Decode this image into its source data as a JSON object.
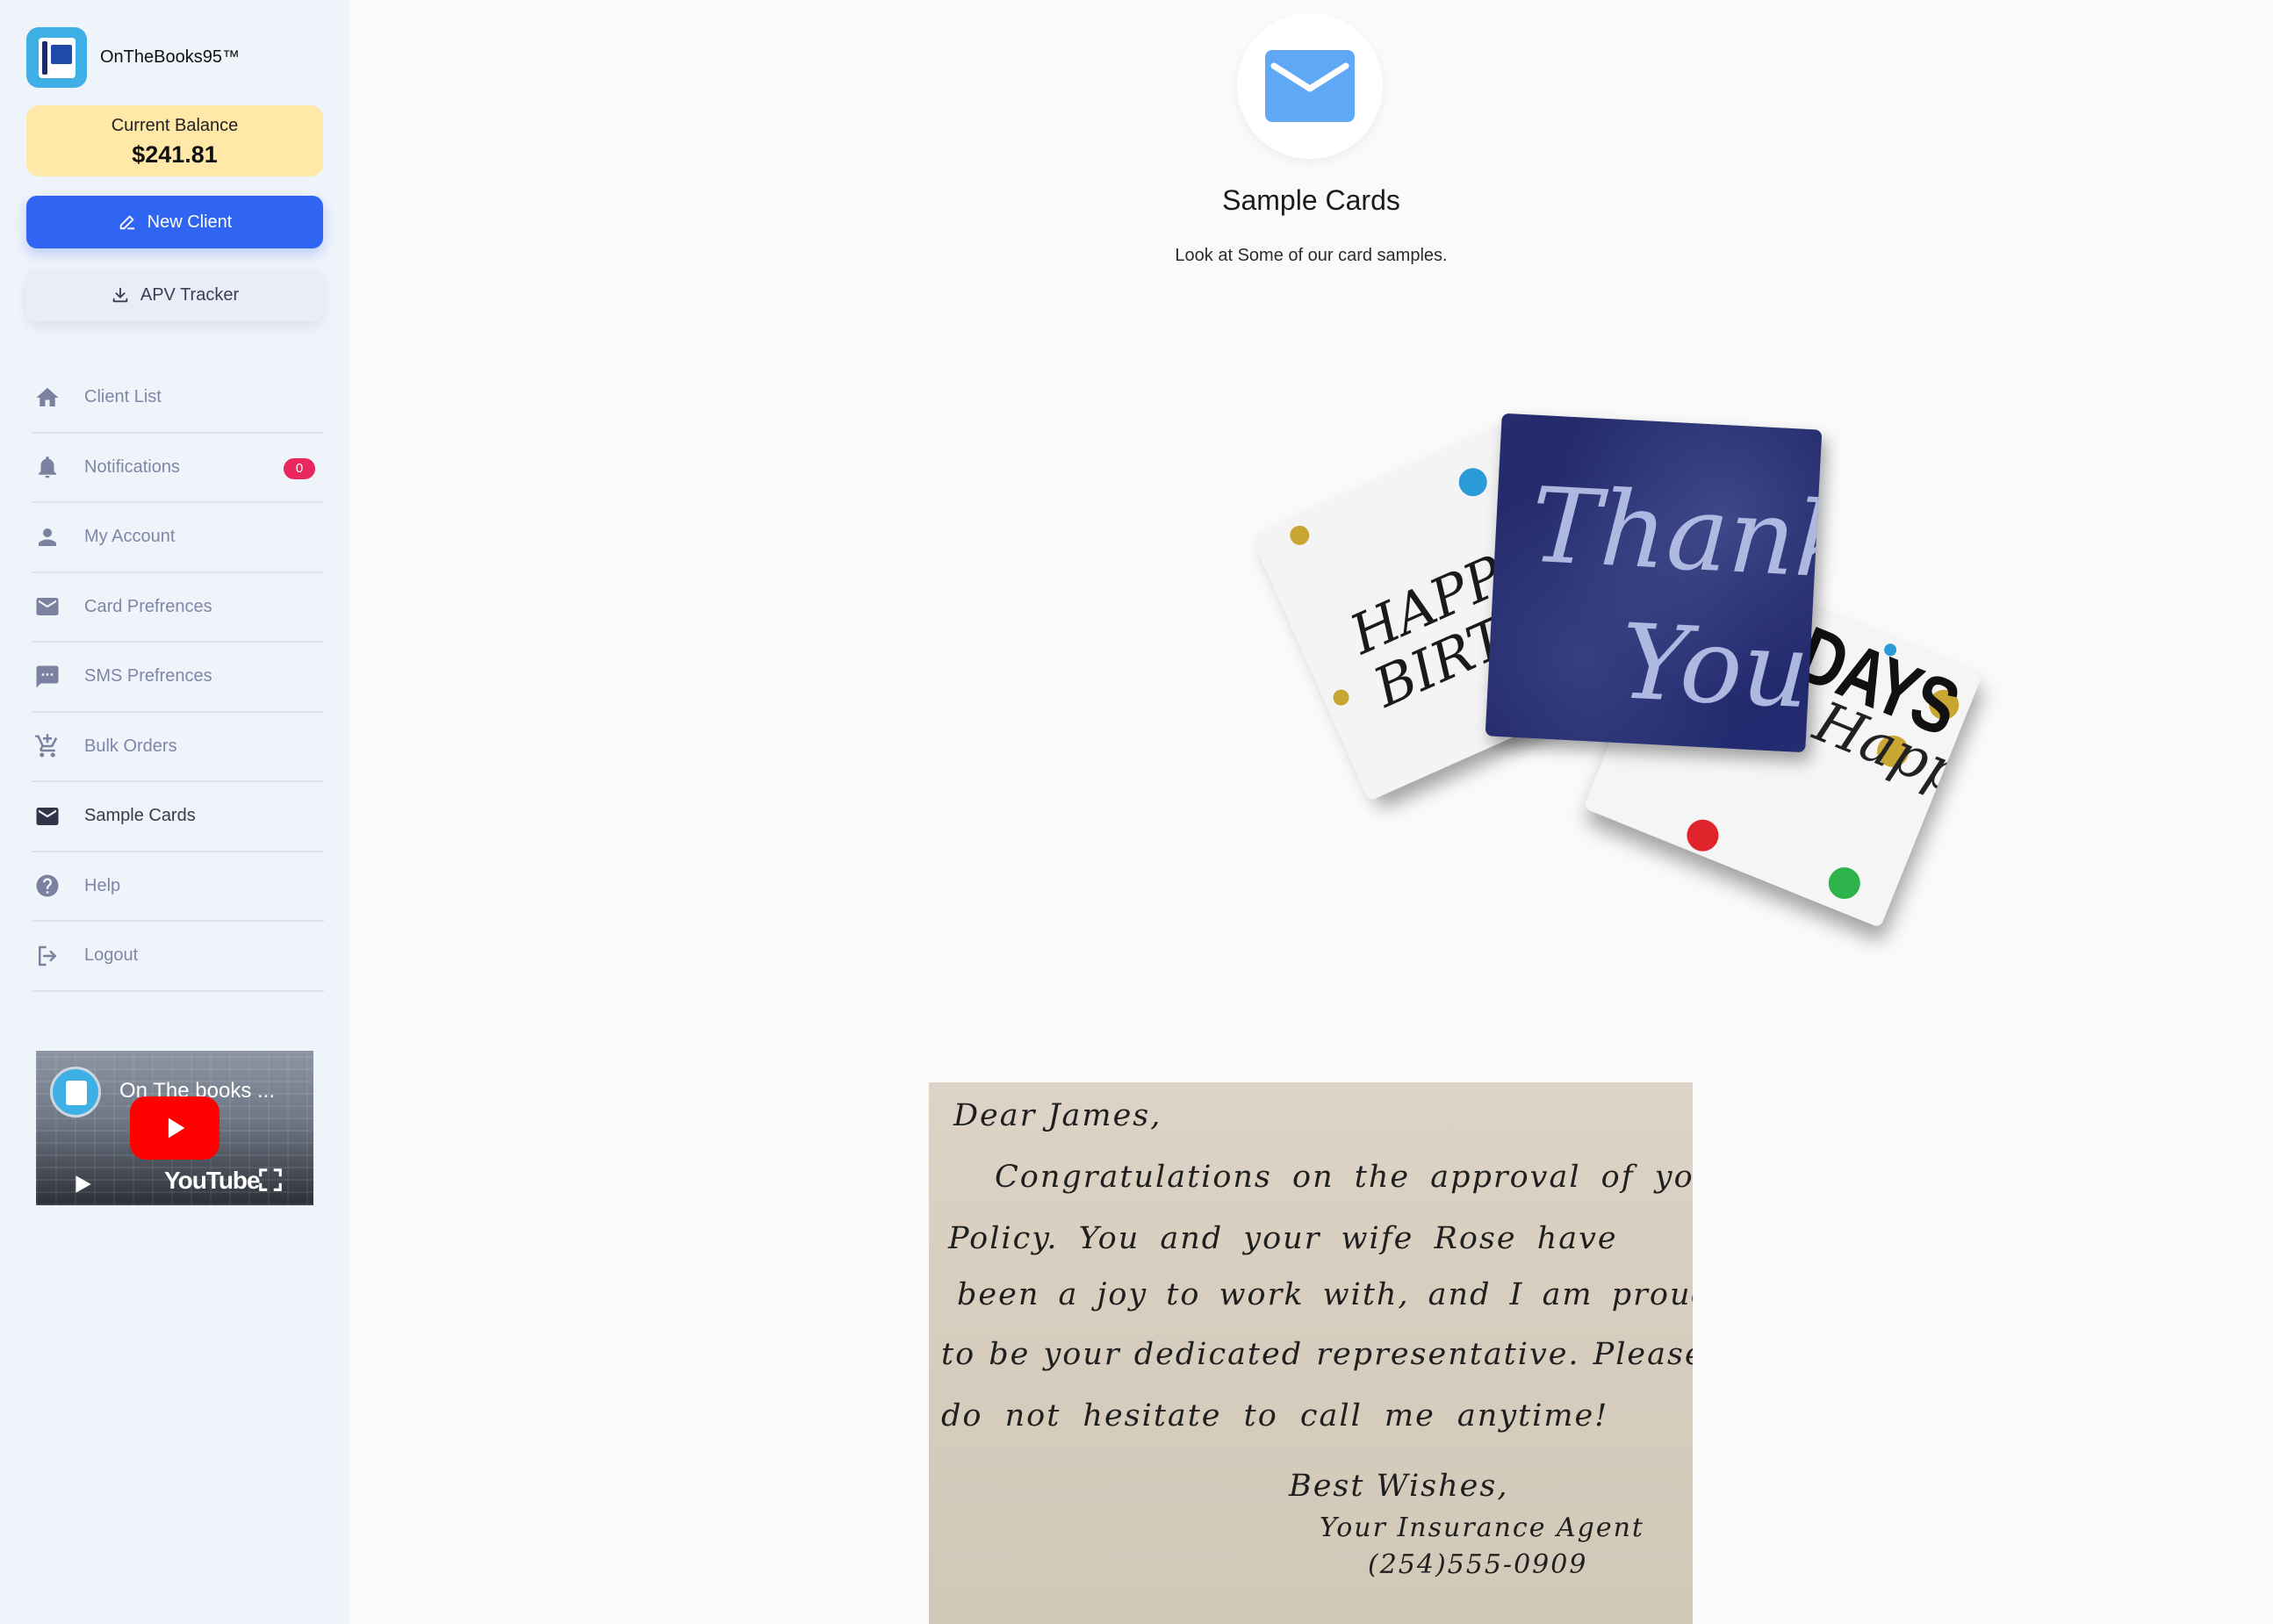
{
  "sidebar": {
    "brand_name": "OnTheBooks95™",
    "balance_label": "Current Balance",
    "balance_value": "$241.81",
    "new_client_label": "New Client",
    "apv_tracker_label": "APV Tracker",
    "nav": [
      {
        "label": "Client List",
        "icon": "home-icon"
      },
      {
        "label": "Notifications",
        "icon": "bell-icon",
        "badge": "0"
      },
      {
        "label": "My Account",
        "icon": "person-icon"
      },
      {
        "label": "Card Prefrences",
        "icon": "mail-icon"
      },
      {
        "label": "SMS Prefrences",
        "icon": "chat-icon"
      },
      {
        "label": "Bulk Orders",
        "icon": "cart-icon"
      },
      {
        "label": "Sample Cards",
        "icon": "mail-icon",
        "active": true
      },
      {
        "label": "Help",
        "icon": "help-icon"
      },
      {
        "label": "Logout",
        "icon": "logout-icon"
      }
    ],
    "video": {
      "title": "On The books ...",
      "platform": "YouTube"
    }
  },
  "main": {
    "title": "Sample Cards",
    "subtitle": "Look at Some of our card samples.",
    "cards": {
      "birthday_text": "HAPPY BIRTHDAY",
      "thank_you_line1": "Thank",
      "thank_you_line2": "You",
      "holidays_script": "Happy",
      "holidays_text": "HOLIDAYS"
    },
    "letter": {
      "lines": [
        "Dear James,",
        "Congratulations on the approval of your",
        "Policy. You and your wife Rose have",
        "been a joy to work with, and I am proud",
        "to be your dedicated representative. Please",
        "do not hesitate to call me anytime!",
        "Best Wishes,",
        "Your Insurance Agent",
        "(254)555-0909"
      ]
    }
  },
  "colors": {
    "primary": "#3064f2",
    "balance_bg": "#ffe8a8",
    "badge": "#e8285e",
    "sidebar_bg": "#eff3fa",
    "nav_text": "#7f86a6"
  }
}
